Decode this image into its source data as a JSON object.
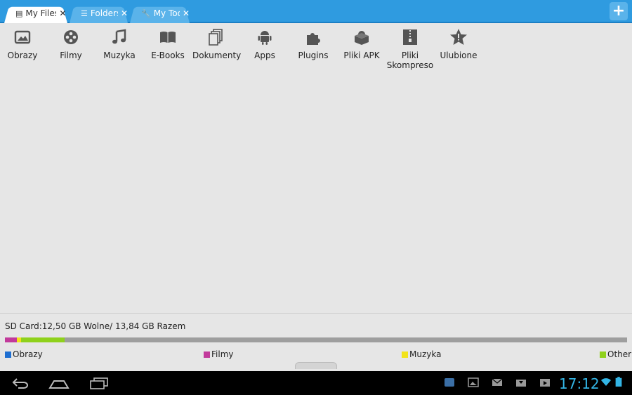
{
  "tabs": [
    {
      "label": "My Files",
      "icon": "document-icon",
      "active": true
    },
    {
      "label": "Folders",
      "icon": "list-icon",
      "active": false
    },
    {
      "label": "My Tools",
      "icon": "wrench-icon",
      "active": false
    }
  ],
  "categories": [
    {
      "label": "Obrazy",
      "icon": "image-icon"
    },
    {
      "label": "Filmy",
      "icon": "film-reel-icon"
    },
    {
      "label": "Muzyka",
      "icon": "music-note-icon"
    },
    {
      "label": "E-Books",
      "icon": "book-icon"
    },
    {
      "label": "Dokumenty",
      "icon": "documents-icon"
    },
    {
      "label": "Apps",
      "icon": "android-icon"
    },
    {
      "label": "Plugins",
      "icon": "puzzle-icon"
    },
    {
      "label": "Pliki APK",
      "icon": "apk-box-icon"
    },
    {
      "label": "Pliki Skompreso",
      "icon": "zip-archive-icon"
    },
    {
      "label": "Ulubione",
      "icon": "star-icon"
    }
  ],
  "storage": {
    "title": "SD Card:12,50 GB Wolne/ 13,84 GB Razem",
    "segments": [
      {
        "name": "Obrazy",
        "color": "#1f6fd1",
        "fraction": 0.0
      },
      {
        "name": "Filmy",
        "color": "#c23a9b",
        "fraction": 0.019
      },
      {
        "name": "Muzyka",
        "color": "#f2e31a",
        "fraction": 0.007
      },
      {
        "name": "Other",
        "color": "#8fd11c",
        "fraction": 0.07
      }
    ],
    "legend": [
      "Obrazy",
      "Filmy",
      "Muzyka",
      "Other"
    ]
  },
  "statusbar": {
    "time": "17:12",
    "accent": "#33b5e5"
  },
  "navbar": {
    "buttons": [
      "back-icon",
      "home-icon",
      "recent-apps-icon"
    ]
  }
}
